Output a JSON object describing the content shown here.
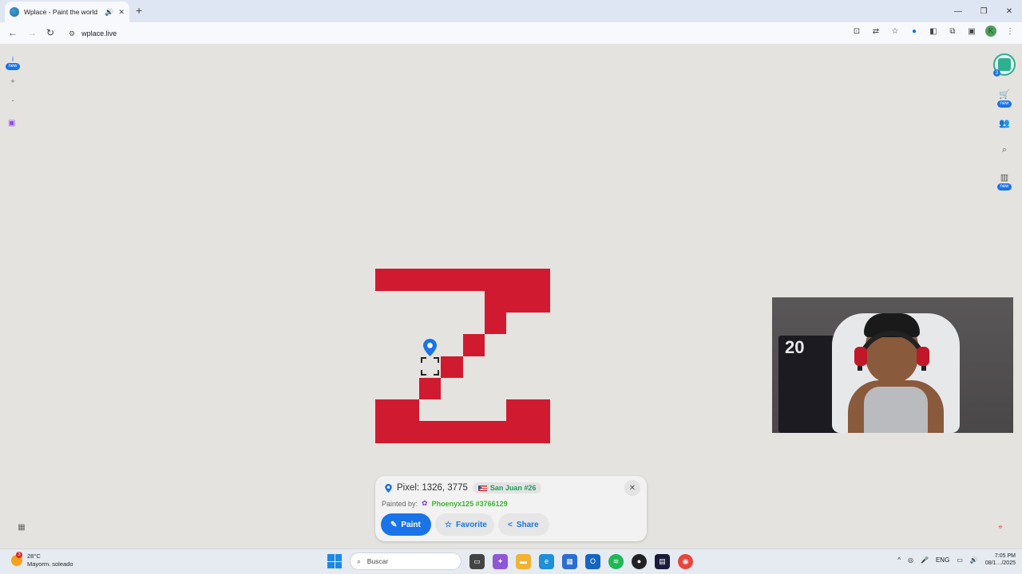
{
  "browser": {
    "tab_title": "Wplace - Paint the world",
    "url": "wplace.live",
    "profile_initial": "K"
  },
  "map": {
    "left_controls": {
      "info_label": "i",
      "info_badge": "new",
      "zoom_in": "+",
      "zoom_out": "-"
    },
    "right_controls": {
      "avatar_count": "3",
      "store_badge": "new",
      "leaderboard_badge": "new"
    }
  },
  "pixel_card": {
    "pixel_text": "Pixel: 1326, 3775",
    "region": "San Juan #26",
    "painted_by_label": "Painted by:",
    "painter": "Phoenyx125 #3766129",
    "paint_label": "Paint",
    "favorite_label": "Favorite",
    "share_label": "Share"
  },
  "taskbar": {
    "weather_temp": "28°C",
    "weather_desc": "Mayorm. soleado",
    "weather_badge": "3",
    "search_placeholder": "Buscar",
    "language": "ENG",
    "clock_time": "7:05 PM",
    "clock_date": "08/1…/2025"
  },
  "colors": {
    "paint_red": "#d01a30",
    "accent_blue": "#1a73e8",
    "map_bg": "#e5e3df",
    "painter_green": "#3cb531"
  }
}
